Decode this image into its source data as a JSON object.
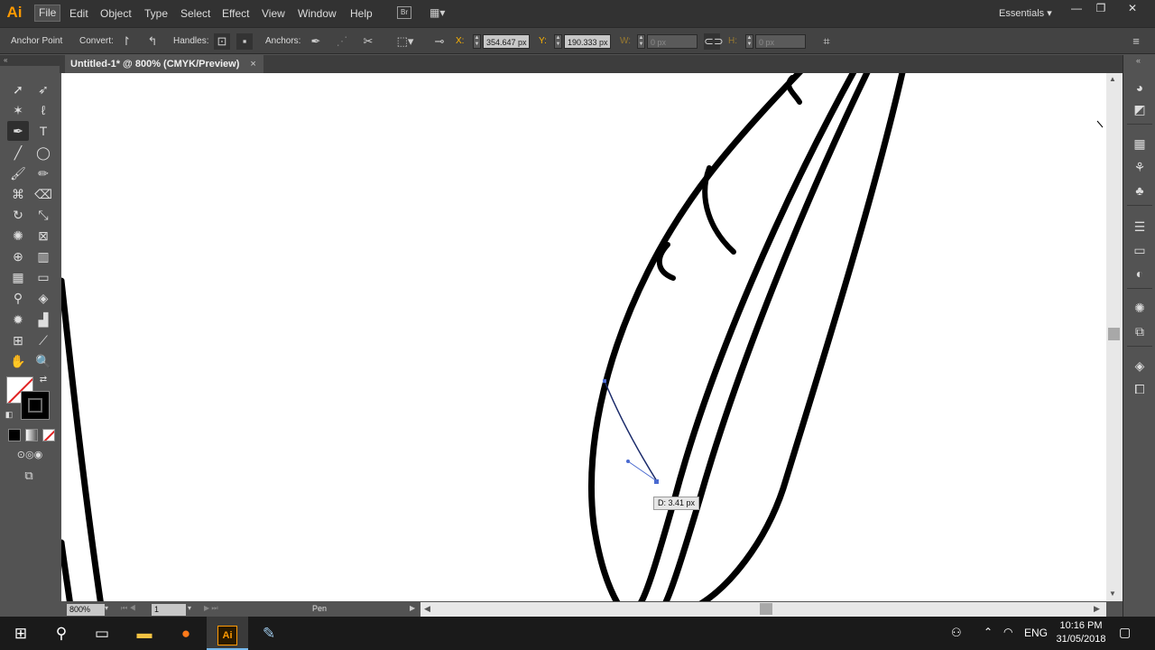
{
  "app": {
    "logo": "Ai",
    "workspace": "Essentials ▾"
  },
  "menu": [
    "File",
    "Edit",
    "Object",
    "Type",
    "Select",
    "Effect",
    "View",
    "Window",
    "Help"
  ],
  "menu_extra": {
    "bridge": "Br"
  },
  "window_controls": {
    "minimize": "—",
    "restore": "❐",
    "close": "✕"
  },
  "control_bar": {
    "tool_name": "Anchor Point",
    "convert_label": "Convert:",
    "handles_label": "Handles:",
    "anchors_label": "Anchors:",
    "x_label": "X:",
    "x_value": "354.647 px",
    "y_label": "Y:",
    "y_value": "190.333 px",
    "w_label": "W:",
    "w_value": "0 px",
    "h_label": "H:",
    "h_value": "0 px"
  },
  "document_tab": {
    "title": "Untitled-1* @ 800% (CMYK/Preview)",
    "close": "×"
  },
  "status_bar": {
    "zoom": "800%",
    "artboard": "1",
    "current_tool": "Pen"
  },
  "tooltip": {
    "text": "D: 3.41 px"
  },
  "taskbar": {
    "language": "ENG",
    "time": "10:16 PM",
    "date": "31/05/2018"
  },
  "colors": {
    "fill": "#ffffff",
    "stroke": "#000000",
    "accent": "#ff9a00",
    "taskbar_active": "#76b9ed"
  }
}
